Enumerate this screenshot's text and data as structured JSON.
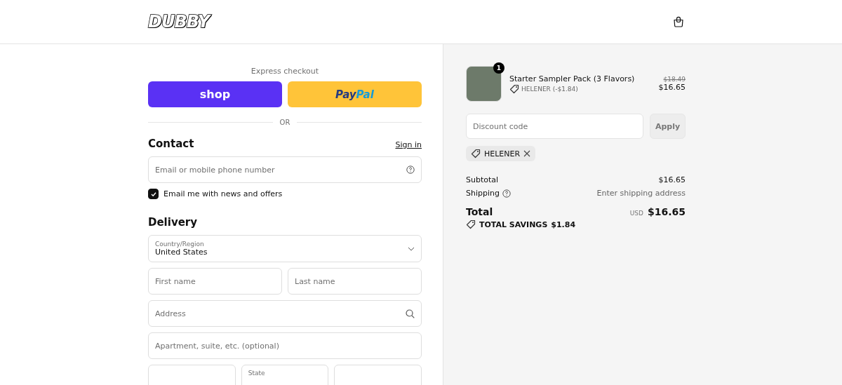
{
  "header": {
    "logo": "DUBBY"
  },
  "express": {
    "title": "Express checkout",
    "buttons": [
      {
        "kind": "shop",
        "label": "shop"
      },
      {
        "kind": "paypal",
        "label": "Pay",
        "label_2": "Pal"
      }
    ],
    "divider": "OR"
  },
  "contact": {
    "title": "Contact",
    "link": "Sign in",
    "email": {
      "placeholder": "Email or mobile phone number"
    },
    "newsletter": {
      "label": "Email me with news and offers",
      "checked": true
    }
  },
  "delivery": {
    "title": "Delivery",
    "country": {
      "label": "Country/Region",
      "value": "United States"
    },
    "fields": [
      [
        {
          "placeholder": "First name"
        },
        {
          "placeholder": "Last name"
        }
      ],
      [
        {
          "placeholder": "Address",
          "kind": "search"
        }
      ],
      [
        {
          "placeholder": "Apartment, suite, etc. (optional)"
        }
      ],
      [
        {
          "kind": "empty"
        },
        {
          "kind": "labelled",
          "label": "State"
        },
        {
          "kind": "empty"
        }
      ]
    ]
  },
  "summary": {
    "items": [
      {
        "name": "Starter Sampler Pack (3 Flavors)",
        "quantity": "1",
        "discount": "HELENER (-$1.84)",
        "old_price": "$18.49",
        "price": "$16.65"
      }
    ],
    "discount": {
      "placeholder": "Discount code",
      "button": "Apply",
      "codes": [
        "HELENER"
      ]
    },
    "rows": [
      {
        "label": "Subtotal",
        "value": "$16.65",
        "help": false
      },
      {
        "label": "Shipping",
        "value": "Enter shipping address",
        "help": true
      }
    ],
    "total": {
      "label": "Total",
      "currency": "USD",
      "value": "$16.65"
    },
    "savings": {
      "label": "TOTAL SAVINGS",
      "value": "$1.84"
    }
  }
}
